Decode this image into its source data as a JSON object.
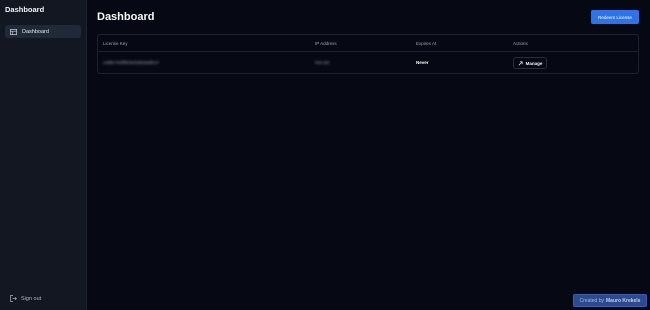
{
  "sidebar": {
    "brand": "Dashboard",
    "nav_items": [
      {
        "label": "Dashboard",
        "icon": "dashboard-icon",
        "active": true
      }
    ],
    "sign_out_label": "Sign out"
  },
  "main": {
    "title": "Dashboard",
    "redeem_button_label": "Redeem License"
  },
  "table": {
    "columns": [
      "License Key",
      "IP Address",
      "Expires At",
      "Actions"
    ],
    "rows": [
      {
        "license_key": "c4d8c7e0f5b3e0a9e9a8bc4",
        "ip_address": "Not set",
        "expires_at": "Never",
        "action_label": "Manage"
      }
    ]
  },
  "footer": {
    "credit_prefix": "Created by",
    "credit_name": "Mauro Krekels"
  },
  "colors": {
    "background": "#060913",
    "sidebar": "#121722",
    "accent": "#2f74e6"
  }
}
